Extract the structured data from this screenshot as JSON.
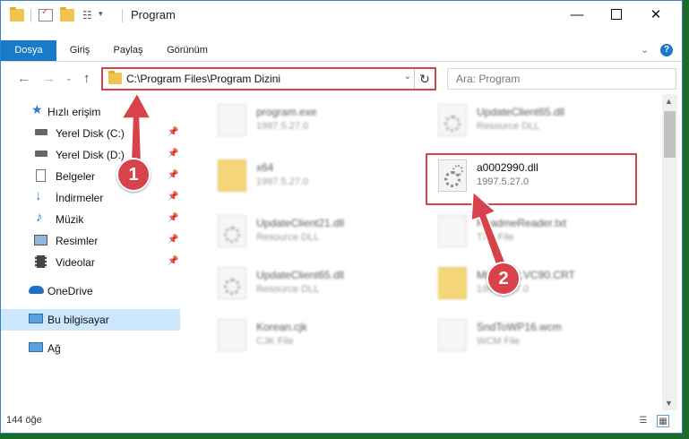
{
  "window": {
    "title": "Program",
    "minimize_icon": "minimize-icon",
    "maximize_icon": "maximize-icon",
    "close_icon": "close-icon"
  },
  "ribbon": {
    "tabs": [
      {
        "label": "Dosya"
      },
      {
        "label": "Giriş"
      },
      {
        "label": "Paylaş"
      },
      {
        "label": "Görünüm"
      }
    ],
    "help": "?"
  },
  "address": {
    "path": "C:\\Program Files\\Program Dizini",
    "refresh_icon": "refresh-icon"
  },
  "search": {
    "placeholder": "Ara: Program"
  },
  "sidebar": {
    "quick_access": "Hızlı erişim",
    "items": [
      {
        "label": "Yerel Disk (C:)",
        "icon": "drive-icon"
      },
      {
        "label": "Yerel Disk (D:)",
        "icon": "drive-icon"
      },
      {
        "label": "Belgeler",
        "icon": "documents-icon"
      },
      {
        "label": "İndirmeler",
        "icon": "download-icon"
      },
      {
        "label": "Müzik",
        "icon": "music-icon"
      },
      {
        "label": "Resimler",
        "icon": "pictures-icon"
      },
      {
        "label": "Videolar",
        "icon": "videos-icon"
      }
    ],
    "onedrive": "OneDrive",
    "this_pc": "Bu bilgisayar",
    "network": "Ağ"
  },
  "files": [
    {
      "name": "program.exe",
      "sub": "1997.5.27.0"
    },
    {
      "name": "UpdateClient65.dll",
      "sub": "Resource DLL"
    },
    {
      "name": "x64",
      "sub": "1997.5.27.0"
    },
    {
      "name": "a0002990.dll",
      "sub": "1997.5.27.0"
    },
    {
      "name": "UpdateClient21.dll",
      "sub": "Resource DLL"
    },
    {
      "name": "ReadmeReader.txt",
      "sub": "TXT File"
    },
    {
      "name": "UpdateClient65.dll",
      "sub": "Resource DLL"
    },
    {
      "name": "Microsoft.VC90.CRT",
      "sub": "1997.5.27.0"
    },
    {
      "name": "Korean.cjk",
      "sub": "CJK File"
    },
    {
      "name": "SndToWP16.wcm",
      "sub": "WCM File"
    }
  ],
  "status": {
    "count": "144 öğe"
  },
  "annotations": [
    {
      "label": "1"
    },
    {
      "label": "2"
    }
  ],
  "colors": {
    "accent": "#1979ca",
    "highlight": "#d8424a",
    "selection": "#cce8ff",
    "desktop": "#1e6a2a"
  }
}
